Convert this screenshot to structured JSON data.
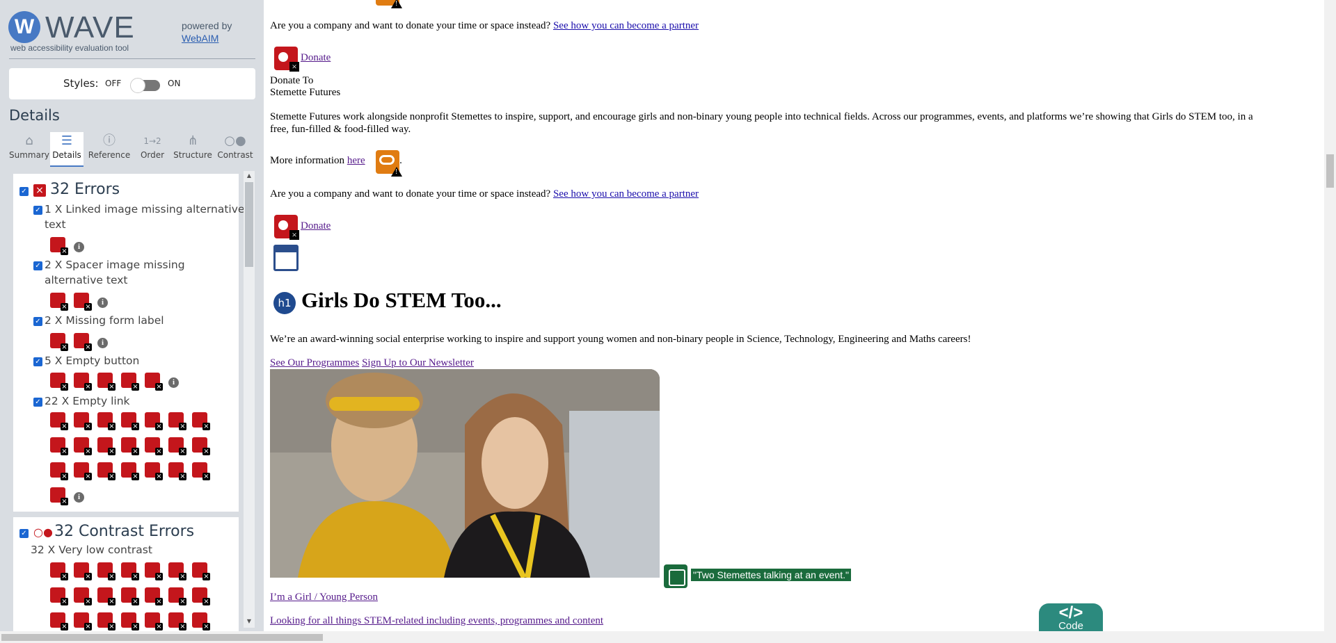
{
  "sidebar": {
    "logo_name": "WAVE",
    "logo_mark": "W",
    "tagline": "web accessibility evaluation tool",
    "powered_by": "powered by",
    "powered_link": "WebAIM",
    "styles_label": "Styles:",
    "styles_off": "OFF",
    "styles_on": "ON",
    "details_heading": "Details",
    "tabs": [
      {
        "label": "Summary",
        "icon": "home-icon"
      },
      {
        "label": "Details",
        "icon": "list-icon"
      },
      {
        "label": "Reference",
        "icon": "info-icon"
      },
      {
        "label": "Order",
        "icon": "order-icon"
      },
      {
        "label": "Structure",
        "icon": "structure-icon"
      },
      {
        "label": "Contrast",
        "icon": "contrast-icon"
      }
    ],
    "errors": {
      "title": "32 Errors",
      "items": [
        {
          "label": "1 X Linked image missing alternative text",
          "count": 1
        },
        {
          "label": "2 X Spacer image missing alternative text",
          "count": 2
        },
        {
          "label": "2 X Missing form label",
          "count": 2
        },
        {
          "label": "5 X Empty button",
          "count": 5
        },
        {
          "label": "22 X Empty link",
          "count": 22
        }
      ]
    },
    "contrast": {
      "title": "32 Contrast Errors",
      "item": "32 X Very low contrast"
    }
  },
  "main": {
    "partner_q1": "Are you a company and want to donate your time or space instead?",
    "partner_link1": "See how you can become a partner",
    "donate1": "Donate",
    "donate_to": "Donate To",
    "org_name": "Stemette Futures",
    "description": "Stemette Futures work alongside nonprofit Stemettes to inspire, support, and encourage girls and non-binary young people into technical fields. Across our programmes, events, and platforms we’re showing that Girls do STEM too, in a",
    "description2": "free, fun-filled & food-filled way.",
    "more_info": "More information",
    "here_link": "here",
    "more_info_end": ".",
    "partner_q2": "Are you a company and want to donate your time or space instead?",
    "partner_link2": "See how you can become a partner",
    "donate2": "Donate",
    "h1_badge": "h1",
    "heading": "Girls Do STEM Too...",
    "intro": "We’re an award-winning social enterprise working to inspire and support young women and non-binary people in Science, Technology, Engineering and Maths careers!",
    "link_programmes": "See Our Programmes",
    "link_newsletter": "Sign Up to Our Newsletter",
    "alt_text": "\"Two Stemettes talking at an event.\"",
    "link_girl": "I’m a Girl / Young Person",
    "link_looking": "Looking for all things STEM-related including events, programmes and content",
    "code_glyph": "</>",
    "code_label": "Code"
  }
}
